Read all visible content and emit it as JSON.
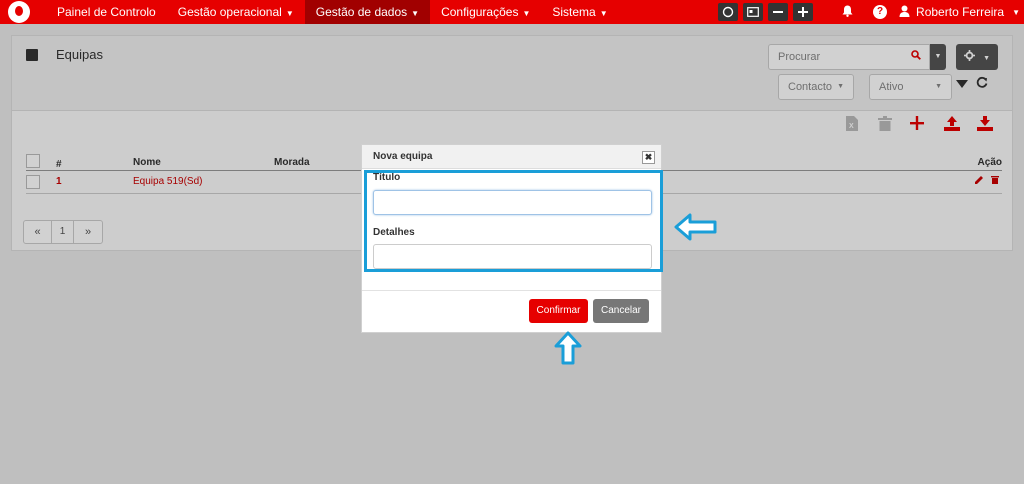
{
  "nav": {
    "items": [
      {
        "label": "Painel de Controlo",
        "caret": ""
      },
      {
        "label": "Gestão operacional",
        "caret": "▼"
      },
      {
        "label": "Gestão de dados",
        "caret": "▼"
      },
      {
        "label": "Configurações",
        "caret": "▼"
      },
      {
        "label": "Sistema",
        "caret": "▼"
      }
    ],
    "active_index": 2,
    "user_name": "Roberto Ferreira",
    "user_caret": "▼"
  },
  "page": {
    "title": "Equipas",
    "search_placeholder": "Procurar",
    "filter_contacto": "Contacto",
    "filter_ativo": "Ativo"
  },
  "table": {
    "headers": {
      "index": "#",
      "name": "Nome",
      "address": "Morada",
      "action": "Ação"
    },
    "rows": [
      {
        "index": "1",
        "name": "Equipa 519(Sd)"
      }
    ]
  },
  "pager": {
    "first": "«",
    "page": "1",
    "last": "»"
  },
  "modal": {
    "title": "Nova equipa",
    "close": "✖",
    "field1_label": "Título",
    "field2_label": "Detalhes",
    "confirm": "Confirmar",
    "cancel": "Cancelar"
  },
  "colors": {
    "brand": "#e60000",
    "highlight": "#1a9ed8"
  }
}
